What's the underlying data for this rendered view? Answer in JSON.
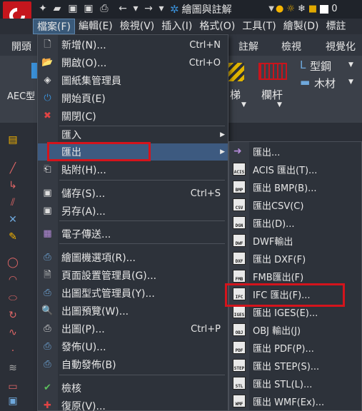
{
  "app": {
    "workspace": "繪圖與註解",
    "layer_value": "0"
  },
  "menubar": {
    "items": [
      "檔案(F)",
      "編輯(E)",
      "檢視(V)",
      "插入(I)",
      "格式(O)",
      "工具(T)",
      "繪製(D)",
      "標註"
    ]
  },
  "ribbon": {
    "tabs": [
      "開頭",
      "註解",
      "檢視",
      "視覺化"
    ],
    "aec_label": "AEC型",
    "stairs_label": "梯",
    "railing_label": "欄杆",
    "profile_label": "型鋼",
    "wood_label": "木材"
  },
  "file_menu": {
    "items": [
      {
        "label": "新增(N)...",
        "shortcut": "Ctrl+N",
        "icon": "new-file-icon"
      },
      {
        "label": "開啟(O)...",
        "shortcut": "Ctrl+O",
        "icon": "open-folder-icon"
      },
      {
        "label": "圖紙集管理員",
        "shortcut": "",
        "icon": "sheet-set-icon"
      },
      {
        "label": "開始頁(E)",
        "shortcut": "",
        "icon": "start-page-icon"
      },
      {
        "label": "關閉(C)",
        "shortcut": "",
        "icon": "close-file-icon"
      },
      {
        "label": "匯入",
        "shortcut": "",
        "icon": ""
      },
      {
        "label": "匯出",
        "shortcut": "",
        "icon": ""
      },
      {
        "label": "貼附(H)...",
        "shortcut": "",
        "icon": "attach-icon"
      },
      {
        "label": "儲存(S)...",
        "shortcut": "Ctrl+S",
        "icon": "save-icon"
      },
      {
        "label": "另存(A)...",
        "shortcut": "",
        "icon": "save-as-icon"
      },
      {
        "label": "電子傳送...",
        "shortcut": "",
        "icon": "etransmit-icon"
      },
      {
        "label": "繪圖機選項(R)...",
        "shortcut": "",
        "icon": "plotter-icon"
      },
      {
        "label": "頁面設置管理員(G)...",
        "shortcut": "",
        "icon": "page-setup-icon"
      },
      {
        "label": "出圖型式管理員(Y)...",
        "shortcut": "",
        "icon": "plot-style-icon"
      },
      {
        "label": "出圖預覽(W)...",
        "shortcut": "",
        "icon": "preview-icon"
      },
      {
        "label": "出圖(P)...",
        "shortcut": "Ctrl+P",
        "icon": "print-icon"
      },
      {
        "label": "發佈(U)...",
        "shortcut": "",
        "icon": "publish-icon"
      },
      {
        "label": "自動發佈(B)",
        "shortcut": "",
        "icon": "auto-publish-icon"
      },
      {
        "label": "檢核",
        "shortcut": "",
        "icon": "audit-icon"
      },
      {
        "label": "復原(V)...",
        "shortcut": "",
        "icon": "recover-icon"
      }
    ]
  },
  "export_menu": {
    "items": [
      {
        "label": "匯出...",
        "icon_text": ""
      },
      {
        "label": "ACIS 匯出(T)...",
        "icon_text": "ACIS"
      },
      {
        "label": "匯出 BMP(B)...",
        "icon_text": "BMP"
      },
      {
        "label": "匯出CSV(C)",
        "icon_text": "CSV"
      },
      {
        "label": "匯出(D)...",
        "icon_text": "DGN"
      },
      {
        "label": "DWF輸出",
        "icon_text": "DWF"
      },
      {
        "label": "匯出 DXF(F)",
        "icon_text": "DXF"
      },
      {
        "label": "FMB匯出(F)",
        "icon_text": "FMB"
      },
      {
        "label": "IFC 匯出(F)...",
        "icon_text": "IFC"
      },
      {
        "label": "匯出 IGES(E)...",
        "icon_text": "IGES"
      },
      {
        "label": "OBJ 輸出(J)",
        "icon_text": "OBJ"
      },
      {
        "label": "匯出 PDF(P)...",
        "icon_text": "PDF"
      },
      {
        "label": "匯出 STEP(S)...",
        "icon_text": "STEP"
      },
      {
        "label": "匯出 STL(L)...",
        "icon_text": "STL"
      },
      {
        "label": "匯出 WMF(Ex)...",
        "icon_text": "WMF"
      }
    ]
  }
}
